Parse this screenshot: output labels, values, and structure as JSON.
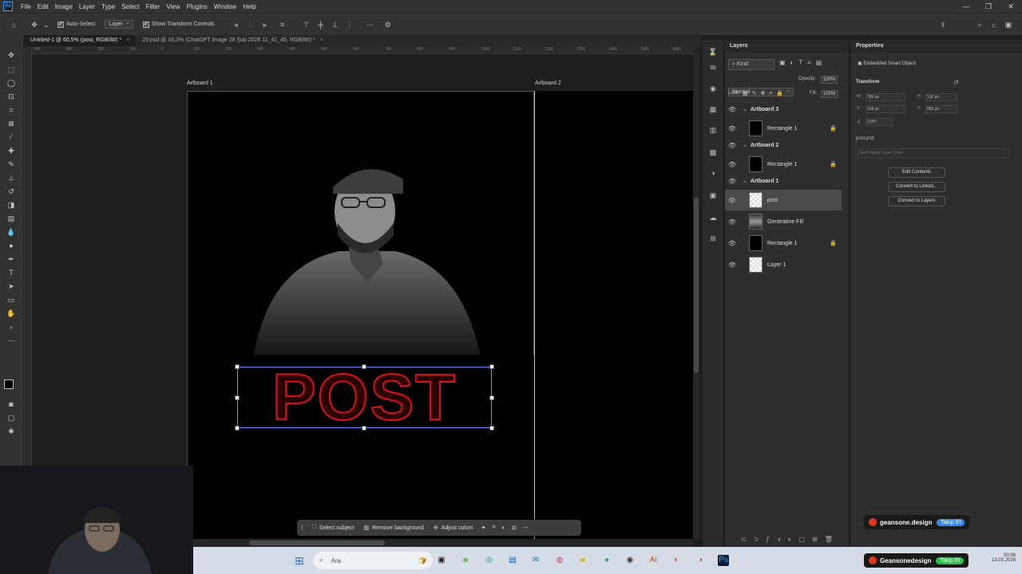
{
  "menubar": {
    "items": [
      "File",
      "Edit",
      "Image",
      "Layer",
      "Type",
      "Select",
      "Filter",
      "View",
      "Plugins",
      "Window",
      "Help"
    ],
    "app_icon": "Ps"
  },
  "options": {
    "auto_select": "Auto-Select",
    "layer_dropdown": "Layer",
    "show_transform": "Show Transform Controls"
  },
  "tabs": [
    {
      "label": "Untitled-1 @ 60,5% (post, RGB/8#) *"
    },
    {
      "label": "29.psd @ 33,3% (ChatGPT Image 28 Şub 2026 11_41_45, RGB/8#) *"
    }
  ],
  "ruler_ticks": [
    "400",
    "300",
    "200",
    "100",
    "0",
    "100",
    "200",
    "300",
    "400",
    "500",
    "600",
    "700",
    "800",
    "900",
    "1000",
    "1100",
    "1200",
    "1300",
    "1400",
    "1500",
    "1600"
  ],
  "canvas": {
    "artboard1_label": "Artboard 1",
    "artboard2_label": "Artboard 2",
    "headline": "POST",
    "headline_color": "#e0101a"
  },
  "context_bar": {
    "select_subject": "Select subject",
    "remove_background": "Remove background",
    "adjust_colors": "Adjust colors"
  },
  "layers": {
    "title": "Layers",
    "kind": "Kind",
    "blend_mode": "Normal",
    "opacity_label": "Opacity:",
    "opacity_value": "100%",
    "lock_label": "Lock:",
    "fill_label": "Fill:",
    "fill_value": "100%",
    "rows": [
      {
        "name": "Artboard 3",
        "type": "group"
      },
      {
        "name": "Rectangle 1",
        "type": "layer",
        "thumb": "black",
        "locked": true
      },
      {
        "name": "Artboard 2",
        "type": "group"
      },
      {
        "name": "Rectangle 1",
        "type": "layer",
        "thumb": "black",
        "locked": true
      },
      {
        "name": "Artboard 1",
        "type": "group"
      },
      {
        "name": "post",
        "type": "layer",
        "thumb": "check",
        "selected": true
      },
      {
        "name": "Generative Fill",
        "type": "layer",
        "thumb": "photo"
      },
      {
        "name": "Rectangle 1",
        "type": "layer",
        "thumb": "black",
        "locked": true
      },
      {
        "name": "Layer 1",
        "type": "layer",
        "thumb": "check"
      }
    ]
  },
  "properties": {
    "title": "Properties",
    "kind": "Embedded Smart Object",
    "transform_label": "Transform",
    "w_label": "W:",
    "w_value": "789 px",
    "h_label": "H:",
    "h_value": "192 px",
    "x_label": "X:",
    "x_value": "158 px",
    "y_label": "Y:",
    "y_value": "855 px",
    "angle": "0,00°",
    "file": "post.psb",
    "layer_comp": "Don't Apply Layer Comp",
    "buttons": [
      "Edit Contents",
      "Convert to Linked...",
      "Convert to Layers"
    ]
  },
  "overlay": {
    "brand1": "geansone.design",
    "toggle1": "Takip Et",
    "brand2": "Geansonedesign",
    "toggle2": "Takip Et"
  },
  "taskbar": {
    "search": "Ara",
    "time": "00:08",
    "date": "13.03.2026"
  }
}
